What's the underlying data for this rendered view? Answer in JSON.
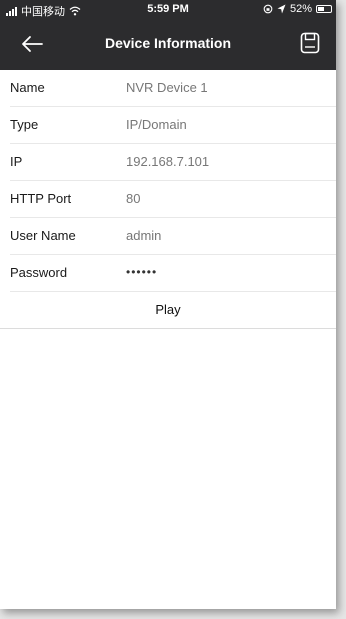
{
  "status_bar": {
    "carrier": "中国移动",
    "time": "5:59 PM",
    "battery": "52%",
    "battery_level": 0.52
  },
  "header": {
    "title": "Device Information",
    "back_icon": "arrow-left-icon",
    "save_icon": "floppy-disk-icon"
  },
  "fields": [
    {
      "label": "Name",
      "value": "NVR Device 1"
    },
    {
      "label": "Type",
      "value": "IP/Domain"
    },
    {
      "label": "IP",
      "value": "192.168.7.101"
    },
    {
      "label": "HTTP Port",
      "value": "80"
    },
    {
      "label": "User Name",
      "value": "admin"
    },
    {
      "label": "Password",
      "value": "••••••"
    }
  ],
  "play_label": "Play",
  "colors": {
    "header_bg": "#2c2c2e",
    "text": "#1a1a1a",
    "value_text": "#777777",
    "divider": "#e8e8e8"
  }
}
